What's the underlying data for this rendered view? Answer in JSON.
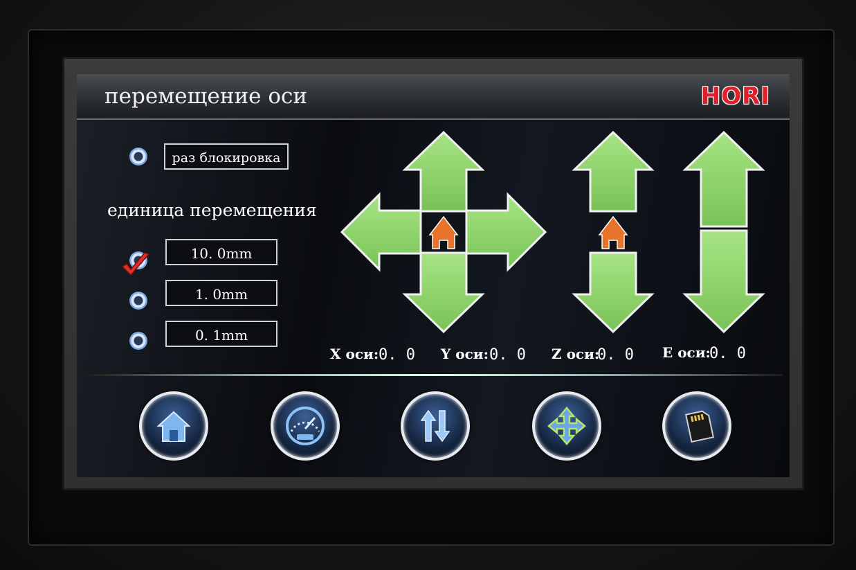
{
  "header": {
    "title": "перемещение оси",
    "brand": "HORI"
  },
  "unlock": {
    "label": "раз блокировка"
  },
  "units": {
    "heading": "единица перемещения",
    "options": [
      {
        "label": "10. 0mm",
        "selected": true
      },
      {
        "label": "1. 0mm",
        "selected": false
      },
      {
        "label": "0. 1mm",
        "selected": false
      }
    ]
  },
  "axes": [
    {
      "label": "X оси:",
      "value": "0. 0"
    },
    {
      "label": "Y оси:",
      "value": "0. 0"
    },
    {
      "label": "Z оси:",
      "value": "0. 0"
    },
    {
      "label": "E оси:",
      "value": "0. 0"
    }
  ],
  "nav": [
    {
      "icon": "home-icon"
    },
    {
      "icon": "speedometer-icon"
    },
    {
      "icon": "extrude-arrows-icon"
    },
    {
      "icon": "move-axis-icon"
    },
    {
      "icon": "sd-card-icon"
    }
  ],
  "colors": {
    "arrow_fill": "#8fd66b",
    "arrow_edge": "#2f6a1c",
    "home_icon": "#e8742c",
    "brand": "#e0202a"
  }
}
